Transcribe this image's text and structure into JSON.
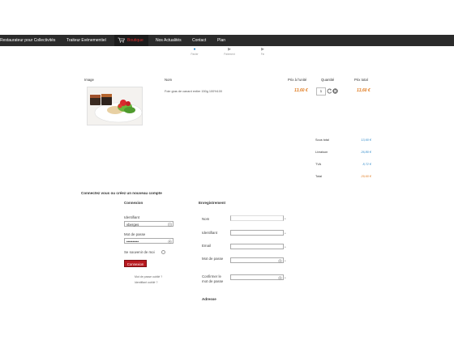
{
  "nav": {
    "items": [
      {
        "label": "Restaurateur pour Collectivités"
      },
      {
        "label": "Traiteur Evénementiel"
      },
      {
        "label": "Boutique"
      },
      {
        "label": "Nos Actualités"
      },
      {
        "label": "Contact"
      },
      {
        "label": "Plan"
      }
    ],
    "active_index": 2
  },
  "steps": [
    {
      "label": "Panier",
      "marker": "●"
    },
    {
      "label": "Paiement",
      "marker": "▶"
    },
    {
      "label": "Fin",
      "marker": "▶"
    }
  ],
  "cart": {
    "headers": {
      "image": "Image",
      "name": "Nom",
      "unit_price": "Prix à l'unité",
      "quantity": "Quantité",
      "total_price": "Prix total"
    },
    "items": [
      {
        "name": "Foie gras de canard entier 150g 100%100",
        "unit_price": "13,60 €",
        "quantity": "1",
        "total": "13,60 €"
      }
    ],
    "summary": [
      {
        "label": "Sous total",
        "value": "13,60 €"
      },
      {
        "label": "Livraison",
        "value": "26,80 €"
      },
      {
        "label": "TVA",
        "value": "8,72 €"
      },
      {
        "label": "Total",
        "value": "29,60 €"
      }
    ]
  },
  "account": {
    "section_title": "Connectez vous ou créez un nouveau compte",
    "login": {
      "title": "Connexion",
      "username_label": "Identifiant",
      "username_value": "vberges",
      "password_label": "Mot de passe",
      "password_value": "••••••••••",
      "remember_label": "Se souvenir de moi",
      "submit_label": "Connexion",
      "forgot_password": "Mot de passe oublié ?",
      "forgot_username": "Identifiant oublié ?"
    },
    "register": {
      "title": "Enregistrement",
      "fields": [
        {
          "label": "Nom"
        },
        {
          "label": "Identifiant"
        },
        {
          "label": "Email"
        },
        {
          "label": "Mot de passe"
        },
        {
          "label": "Confirmer le mot de passe"
        }
      ],
      "required_mark": "*",
      "address_title": "Adresse"
    }
  }
}
